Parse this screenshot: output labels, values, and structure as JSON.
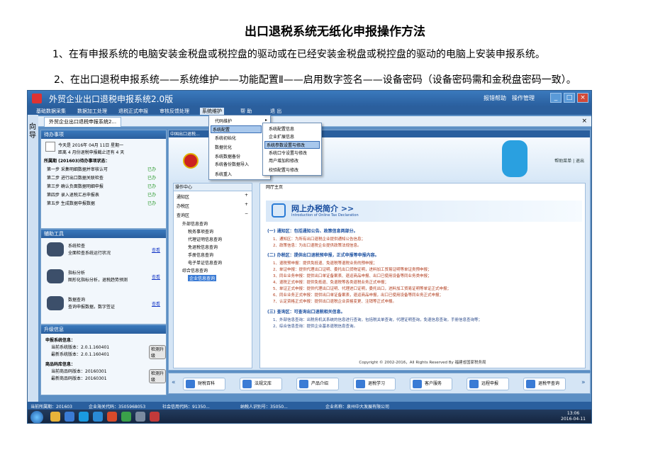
{
  "doc": {
    "title": "出口退税系统无纸化申报操作方法",
    "step1": "1、在有申报系统的电脑安装金税盘或税控盘的驱动或在已经安装金税盘或税控盘的驱动的电脑上安装申报系统。",
    "step2": "2、在出口退税申报系统——系统维护——功能配置Ⅱ——启用数字签名——设备密码（设备密码需和金税盘密码一致）。"
  },
  "app": {
    "title": "外贸企业出口退税申报系统2.0版",
    "title_links": [
      "报错帮助",
      "操作管理"
    ],
    "menus": [
      "基础数据采集",
      "数据加工处理",
      "退税正式申报",
      "审核反馈处理",
      "系统维护",
      "帮 助",
      "退 出"
    ],
    "active_menu": "系统维护",
    "left_strip_label": "向导",
    "tab_label": "外贸企业出口退税申报系统2..."
  },
  "dropdown_main": {
    "items": [
      "代码维护",
      "系统配置",
      "系统初始化",
      "数据优化",
      "系统数据备份",
      "系统备份数据导入",
      "系统重入"
    ]
  },
  "dropdown_sub": {
    "items": [
      "系统配置信息",
      "企业扩展信息",
      "系统参数设置与修改",
      "系统口令设置与修改",
      "用户增加和修改",
      "校验配置与修改"
    ],
    "selected": "系统参数设置与修改"
  },
  "todo": {
    "header": "待办事项",
    "date_line": "今天是 2016年 04月 11日 星期一",
    "notice": "距离 4 月份退税申报截止还有 4 天",
    "month_title": "所属期 (201603)待办事项状态：",
    "steps": [
      {
        "label": "第一步  采集明细数据并审核认可",
        "status": "已办"
      },
      {
        "label": "第二步  进行出口数据关联检查",
        "status": "已办"
      },
      {
        "label": "第三步  确认负面数据明细申报",
        "status": "已办"
      },
      {
        "label": "第四步  录入退税汇总申报表",
        "status": "已办"
      },
      {
        "label": "第五步  生成数据申报数据",
        "status": "已办"
      }
    ]
  },
  "tools": {
    "header": "辅助工具",
    "items": [
      {
        "title": "系统检查",
        "desc": "全面检查系统运行状况",
        "link": "查看"
      },
      {
        "title": "指标分析",
        "desc": "图形化指标分析，退税趋势预测",
        "link": "查看"
      },
      {
        "title": "数据查询",
        "desc": "查询申报数据，数字签证",
        "link": "查看"
      }
    ]
  },
  "upgrade": {
    "header": "升级信息",
    "sys_title": "申报系统信息：",
    "sys_current": "当前系统版本：2.0.1.160401",
    "sys_latest": "最新系统版本：2.0.1.160401",
    "sys_btn": "检测升级",
    "code_title": "商品码库信息：",
    "code_current": "当前商品码版本：20160301",
    "code_latest": "最新商品码版本：20160301",
    "code_btn": "检测升级"
  },
  "main": {
    "head": "中国出口退税...",
    "help_links": "帮助菜单  |  退出",
    "nav_header": "操作中心",
    "nav": [
      "通知区",
      "办税区",
      "查询区",
      "外部信息查询",
      "税务事项查询",
      "代理证明信息查询",
      "免退税信息查询",
      "手册信息查询",
      "电子单证信息查询",
      "综合信息查询",
      "企业信息查询"
    ],
    "nav_selected": "企业信息查询",
    "content_tab": "网厅主页",
    "intro_title": "网上办税简介 >>",
    "intro_sub": "Introduction of Online Tax Declaration",
    "sec1": "(一) 通知区：包括通知公告、政策信息两部分。",
    "sec1_lines": [
      "1、通知区：为所有出口退税企业提供通知公告信息；",
      "2、政策信息：为出口退税企业提供政策法规信息。"
    ],
    "sec2": "(二) 办税区：提供出口退税预申报，正式申报等申报内容。",
    "sec2_lines": [
      "1、退税预申报：提供免抵退、免退税等退税业务的预申报；",
      "2、单证申报：提供代理出口证明、委托出口货物证明，进料加工贸易证明等单证类预申报；",
      "3、同业业务申报：提供出口单证备案表、退运商品申报、出口已使用设备等同业务类申报；",
      "4、退税正式申报：提供免抵退、免退税等各类退税业务正式申报；",
      "5、单证正式申报：提供代理出口证明、代理进口证明，委托出口，进料加工贸易证明等单证正式申报；",
      "6、同业业务正式申报：提供出口单证备案表，退运商品申报，出口已使用设备等同业务正式申报；",
      "7、认定资格正式申报：提供出口退税企业资格变更、注销等正式申报。"
    ],
    "sec3": "(三) 查询区：可查询出口退税相关信息。",
    "sec3_lines": [
      "1、外部信息查询：出税务机关系统的信息进行查询，包括税关单查询，代理证明查询，免退信息查询，手册信息查询等；",
      "2、综合信息查询：提供企业基本退税信息查询。"
    ],
    "copyright": "Copyright © 2002-2016，All Rights Reserved By 福建省国家税务局"
  },
  "quickbar": {
    "buttons": [
      "财税百科",
      "法规文库",
      "产品介绍",
      "退税学习",
      "客户服务",
      "远程申报",
      "退税平查询"
    ]
  },
  "statusbar": {
    "items": [
      "当前所属期：201603",
      "企业海关代码：3505968053",
      "社会信用代码：91350...",
      "纳税人识别号：35050...",
      "企业名称：泉州中大发展有限公司"
    ]
  },
  "taskbar": {
    "time": "13:06",
    "date": "2016-04-11"
  }
}
